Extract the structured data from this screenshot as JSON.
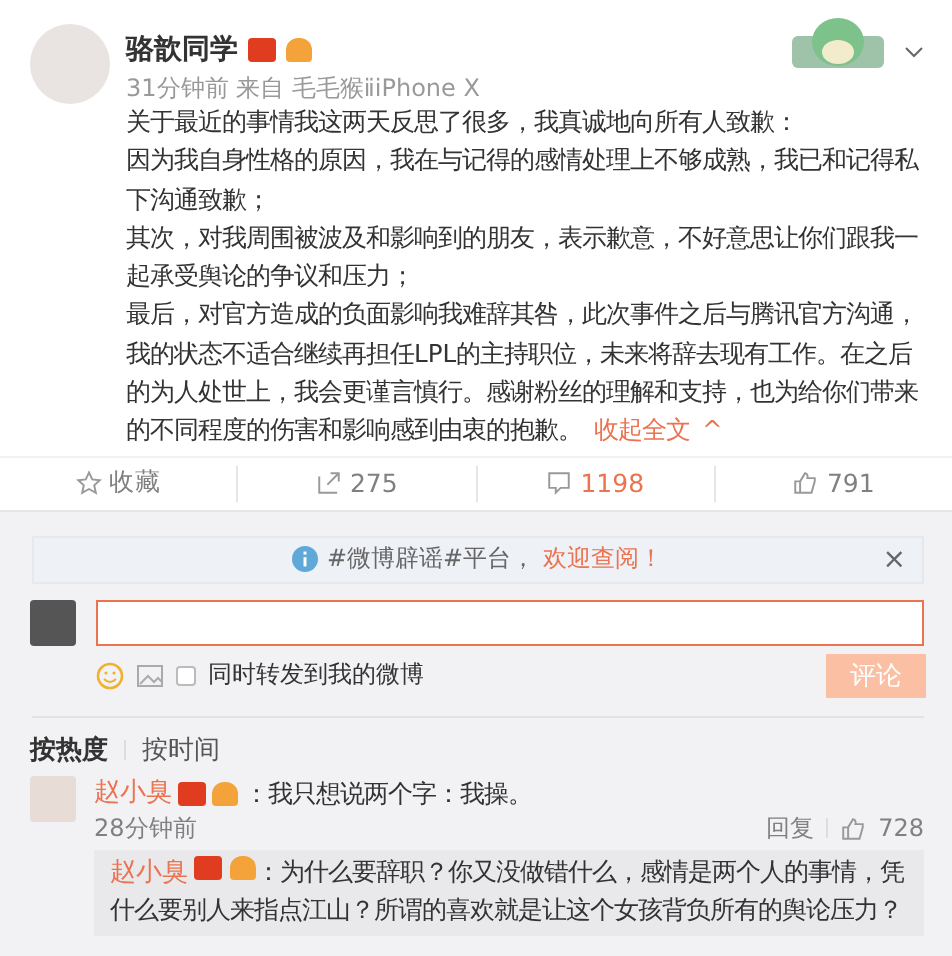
{
  "post": {
    "author": "骆歆同学",
    "meta": "31分钟前 来自 毛毛猴ⅱiPhone X",
    "paragraphs": [
      "关于最近的事情我这两天反思了很多，我真诚地向所有人致歉：",
      "因为我自身性格的原因，我在与记得的感情处理上不够成熟，我已和记得私下沟通致歉；",
      "其次，对我周围被波及和影响到的朋友，表示歉意，不好意思让你们跟我一起承受舆论的争议和压力；",
      "最后，对官方造成的负面影响我难辞其咎，此次事件之后与腾讯官方沟通，我的状态不适合继续再担任LPL的主持职位，未来将辞去现有工作。在之后的为人处世上，我会更谨言慎行。感谢粉丝的理解和支持，也为给你们带来的不同程度的伤害和影响感到由衷的抱歉。"
    ],
    "collapse_link": "收起全文",
    "collapse_arrow": "^"
  },
  "actions": [
    {
      "kind": "favorite",
      "label": "收藏",
      "selected": false
    },
    {
      "kind": "repost",
      "label": "275",
      "selected": false
    },
    {
      "kind": "comment",
      "label": "1198",
      "selected": true
    },
    {
      "kind": "like",
      "label": "791",
      "selected": false
    }
  ],
  "notice": {
    "text": "#微博辟谣#平台，",
    "highlight": "欢迎查阅！",
    "close": "×"
  },
  "composer": {
    "repost_label": "同时转发到我的微博",
    "repost_checked": false,
    "submit": "评论"
  },
  "sort_tabs": [
    {
      "label": "按热度",
      "selected": true
    },
    {
      "label": "按时间",
      "selected": false
    }
  ],
  "comments": [
    {
      "author": "赵小臭",
      "text": "：我只想说两个字：我操。",
      "time": "28分钟前",
      "reply": "回复",
      "likes": "728",
      "replies": [
        {
          "author": "赵小臭",
          "text": "：为什么要辞职？你又没做错什么，感情是两个人的事情，凭什么要别人来指点江山？所谓的喜欢就是让这个女孩背负所有的舆论压力？"
        }
      ]
    }
  ]
}
